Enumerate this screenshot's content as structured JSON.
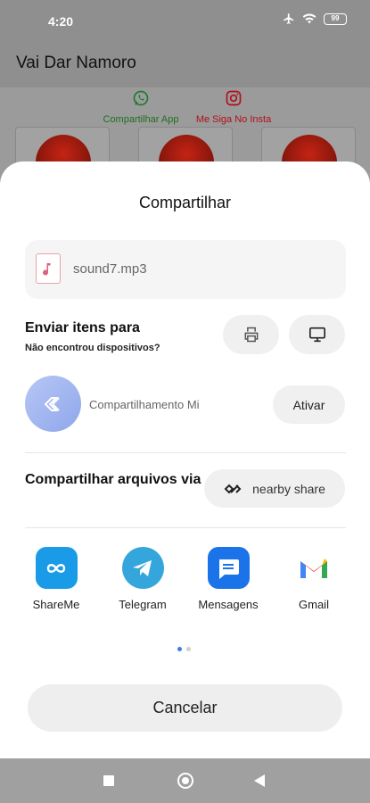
{
  "status_bar": {
    "time": "4:20",
    "battery": "99"
  },
  "app": {
    "title": "Vai Dar Namoro",
    "share_app_label": "Compartilhar App",
    "instagram_label": "Me Siga No Insta"
  },
  "sheet": {
    "title": "Compartilhar",
    "file_name": "sound7.mp3",
    "send_title": "Enviar itens para",
    "send_subtitle": "Não encontrou dispositivos?",
    "mi_share_label": "Compartilhamento Mi",
    "activate_label": "Ativar",
    "via_title": "Compartilhar arquivos via",
    "nearby_label": "nearby share",
    "apps": [
      {
        "label": "ShareMe",
        "color": "#1a9be8"
      },
      {
        "label": "Telegram",
        "color": "#34a6dc"
      },
      {
        "label": "Mensagens",
        "color": "#1a73e8"
      },
      {
        "label": "Gmail",
        "color": "#ea4335"
      }
    ],
    "page_indicator": {
      "current": 1,
      "total": 2
    },
    "cancel_label": "Cancelar"
  },
  "colors": {
    "whatsapp": "#25a244",
    "instagram": "#c8102e",
    "accent": "#3c7de6"
  }
}
